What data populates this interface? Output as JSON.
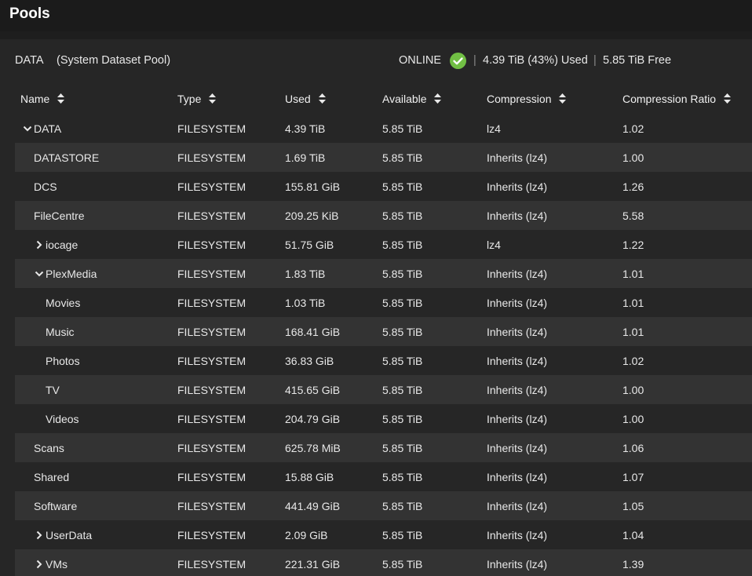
{
  "page": {
    "title": "Pools"
  },
  "pool": {
    "name": "DATA",
    "subtitle": "(System Dataset Pool)",
    "status": "ONLINE",
    "separator": "|",
    "used": "4.39 TiB (43%) Used",
    "free": "5.85 TiB Free",
    "status_color": "#71bf44"
  },
  "columns": {
    "name": "Name",
    "type": "Type",
    "used": "Used",
    "available": "Available",
    "compression": "Compression",
    "ratio": "Compression Ratio"
  },
  "icons": {
    "status": "check-circle-icon",
    "sort": "sort-arrows-icon",
    "expanded": "chevron-down-icon",
    "collapsed": "chevron-right-icon"
  },
  "rows": [
    {
      "name": "DATA",
      "level": 0,
      "toggle": "expanded",
      "type": "FILESYSTEM",
      "used": "4.39 TiB",
      "available": "5.85 TiB",
      "compression": "lz4",
      "ratio": "1.02"
    },
    {
      "name": "DATASTORE",
      "level": 1,
      "toggle": "none",
      "type": "FILESYSTEM",
      "used": "1.69 TiB",
      "available": "5.85 TiB",
      "compression": "Inherits (lz4)",
      "ratio": "1.00"
    },
    {
      "name": "DCS",
      "level": 1,
      "toggle": "none",
      "type": "FILESYSTEM",
      "used": "155.81 GiB",
      "available": "5.85 TiB",
      "compression": "Inherits (lz4)",
      "ratio": "1.26"
    },
    {
      "name": "FileCentre",
      "level": 1,
      "toggle": "none",
      "type": "FILESYSTEM",
      "used": "209.25 KiB",
      "available": "5.85 TiB",
      "compression": "Inherits (lz4)",
      "ratio": "5.58"
    },
    {
      "name": "iocage",
      "level": 1,
      "toggle": "collapsed",
      "type": "FILESYSTEM",
      "used": "51.75 GiB",
      "available": "5.85 TiB",
      "compression": "lz4",
      "ratio": "1.22"
    },
    {
      "name": "PlexMedia",
      "level": 1,
      "toggle": "expanded",
      "type": "FILESYSTEM",
      "used": "1.83 TiB",
      "available": "5.85 TiB",
      "compression": "Inherits (lz4)",
      "ratio": "1.01"
    },
    {
      "name": "Movies",
      "level": 2,
      "toggle": "none",
      "type": "FILESYSTEM",
      "used": "1.03 TiB",
      "available": "5.85 TiB",
      "compression": "Inherits (lz4)",
      "ratio": "1.01"
    },
    {
      "name": "Music",
      "level": 2,
      "toggle": "none",
      "type": "FILESYSTEM",
      "used": "168.41 GiB",
      "available": "5.85 TiB",
      "compression": "Inherits (lz4)",
      "ratio": "1.01"
    },
    {
      "name": "Photos",
      "level": 2,
      "toggle": "none",
      "type": "FILESYSTEM",
      "used": "36.83 GiB",
      "available": "5.85 TiB",
      "compression": "Inherits (lz4)",
      "ratio": "1.02"
    },
    {
      "name": "TV",
      "level": 2,
      "toggle": "none",
      "type": "FILESYSTEM",
      "used": "415.65 GiB",
      "available": "5.85 TiB",
      "compression": "Inherits (lz4)",
      "ratio": "1.00"
    },
    {
      "name": "Videos",
      "level": 2,
      "toggle": "none",
      "type": "FILESYSTEM",
      "used": "204.79 GiB",
      "available": "5.85 TiB",
      "compression": "Inherits (lz4)",
      "ratio": "1.00"
    },
    {
      "name": "Scans",
      "level": 1,
      "toggle": "none",
      "type": "FILESYSTEM",
      "used": "625.78 MiB",
      "available": "5.85 TiB",
      "compression": "Inherits (lz4)",
      "ratio": "1.06"
    },
    {
      "name": "Shared",
      "level": 1,
      "toggle": "none",
      "type": "FILESYSTEM",
      "used": "15.88 GiB",
      "available": "5.85 TiB",
      "compression": "Inherits (lz4)",
      "ratio": "1.07"
    },
    {
      "name": "Software",
      "level": 1,
      "toggle": "none",
      "type": "FILESYSTEM",
      "used": "441.49 GiB",
      "available": "5.85 TiB",
      "compression": "Inherits (lz4)",
      "ratio": "1.05"
    },
    {
      "name": "UserData",
      "level": 1,
      "toggle": "collapsed",
      "type": "FILESYSTEM",
      "used": "2.09 GiB",
      "available": "5.85 TiB",
      "compression": "Inherits (lz4)",
      "ratio": "1.04"
    },
    {
      "name": "VMs",
      "level": 1,
      "toggle": "collapsed",
      "type": "FILESYSTEM",
      "used": "221.31 GiB",
      "available": "5.85 TiB",
      "compression": "Inherits (lz4)",
      "ratio": "1.39"
    }
  ]
}
